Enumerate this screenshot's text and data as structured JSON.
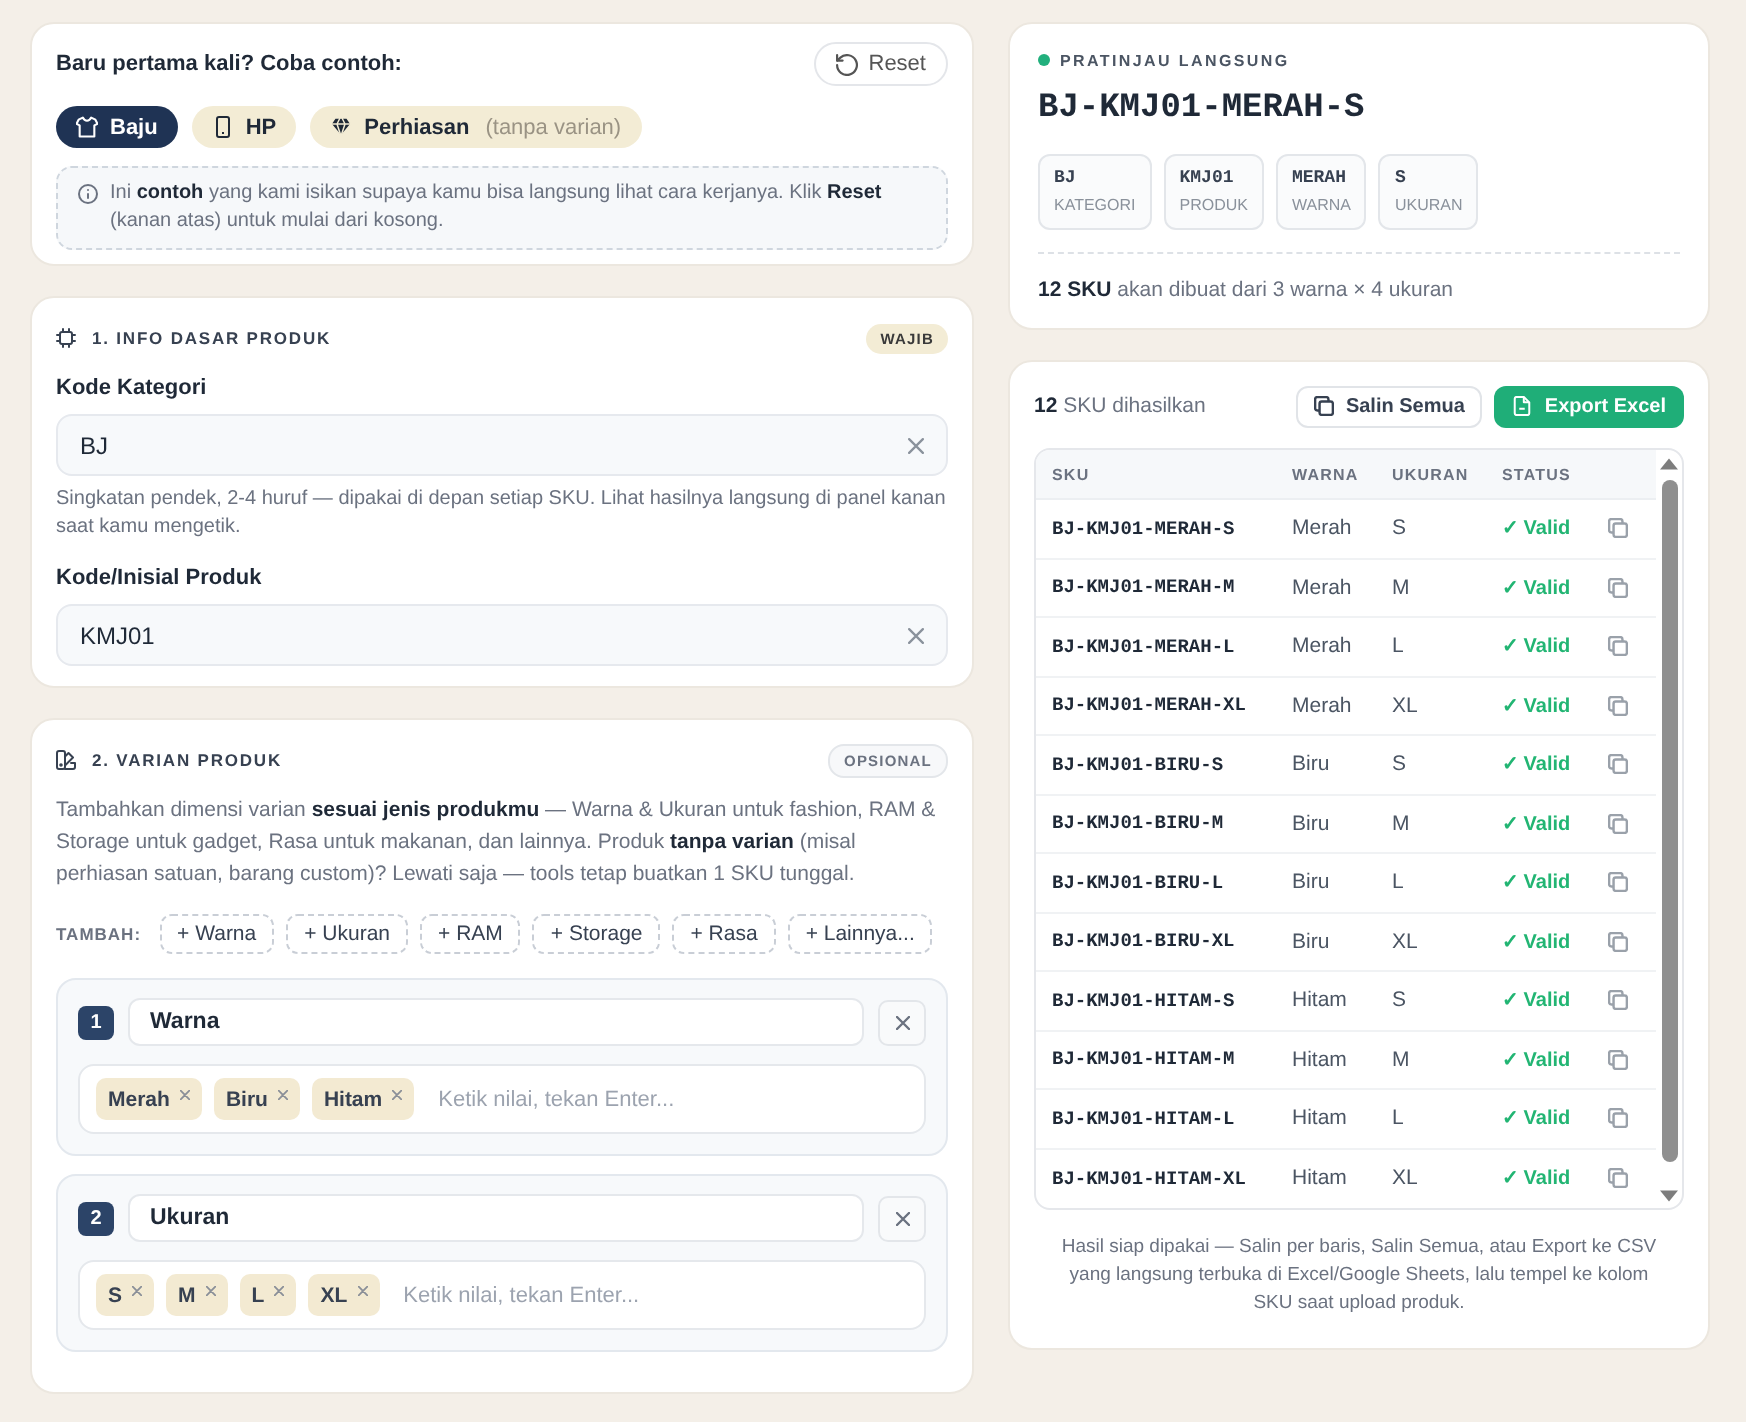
{
  "examples": {
    "title": "Baru pertama kali? Coba contoh:",
    "reset": "Reset",
    "items": [
      {
        "kind": "clothing",
        "label": "Baju",
        "selected": true
      },
      {
        "kind": "gadget",
        "label": "HP",
        "selected": false
      },
      {
        "kind": "jewelry",
        "label": "Perhiasan",
        "note": "(tanpa varian)",
        "selected": false
      }
    ],
    "info": "Ini **contoh** yang kami isikan supaya kamu bisa langsung lihat cara kerjanya. Klik **Reset** (kanan atas) untuk mulai dari kosong."
  },
  "basic_info": {
    "title": "1. INFO DASAR PRODUK",
    "badge": {
      "label": "WAJIB",
      "kind": "required"
    },
    "fields": [
      {
        "label": "Kode Kategori",
        "value": "BJ",
        "hint": "Singkatan pendek, 2-4 huruf — dipakai di depan setiap SKU. Lihat hasilnya langsung di panel kanan saat kamu mengetik."
      },
      {
        "label": "Kode/Inisial Produk",
        "value": "KMJ01"
      }
    ]
  },
  "variants": {
    "title": "2. VARIAN PRODUK",
    "badge": {
      "label": "OPSIONAL",
      "kind": "optional"
    },
    "description": "Tambahkan dimensi varian **sesuai jenis produkmu** — Warna & Ukuran untuk fashion, RAM & Storage untuk gadget, Rasa untuk makanan, dan lainnya. Produk **tanpa varian** (misal perhiasan satuan, barang custom)? Lewati saja — tools tetap buatkan 1 SKU tunggal.",
    "add_label": "TAMBAH:",
    "add_buttons": [
      "+ Warna",
      "+ Ukuran",
      "+ RAM",
      "+ Storage",
      "+ Rasa",
      "+ Lainnya..."
    ],
    "groups": [
      {
        "number": "1",
        "name": "Warna",
        "values": [
          "Merah",
          "Biru",
          "Hitam"
        ],
        "placeholder": "Ketik nilai, tekan Enter..."
      },
      {
        "number": "2",
        "name": "Ukuran",
        "values": [
          "S",
          "M",
          "L",
          "XL"
        ],
        "placeholder": "Ketik nilai, tekan Enter..."
      }
    ]
  },
  "preview": {
    "title": "PRATINJAU LANGSUNG",
    "sku": "BJ-KMJ01-MERAH-S",
    "segments": [
      {
        "value": "BJ",
        "label": "KATEGORI"
      },
      {
        "value": "KMJ01",
        "label": "PRODUK"
      },
      {
        "value": "MERAH",
        "label": "WARNA"
      },
      {
        "value": "S",
        "label": "UKURAN"
      }
    ],
    "summary": "**12 SKU** akan dibuat dari 3 warna × 4 ukuran"
  },
  "results": {
    "count": "**12** SKU dihasilkan",
    "copy_all": "Salin Semua",
    "export": "Export Excel",
    "columns": [
      "SKU",
      "WARNA",
      "UKURAN",
      "STATUS"
    ],
    "rows": [
      {
        "sku": "BJ-KMJ01-MERAH-S",
        "warna": "Merah",
        "ukuran": "S",
        "status": "✓ Valid"
      },
      {
        "sku": "BJ-KMJ01-MERAH-M",
        "warna": "Merah",
        "ukuran": "M",
        "status": "✓ Valid"
      },
      {
        "sku": "BJ-KMJ01-MERAH-L",
        "warna": "Merah",
        "ukuran": "L",
        "status": "✓ Valid"
      },
      {
        "sku": "BJ-KMJ01-MERAH-XL",
        "warna": "Merah",
        "ukuran": "XL",
        "status": "✓ Valid"
      },
      {
        "sku": "BJ-KMJ01-BIRU-S",
        "warna": "Biru",
        "ukuran": "S",
        "status": "✓ Valid"
      },
      {
        "sku": "BJ-KMJ01-BIRU-M",
        "warna": "Biru",
        "ukuran": "M",
        "status": "✓ Valid"
      },
      {
        "sku": "BJ-KMJ01-BIRU-L",
        "warna": "Biru",
        "ukuran": "L",
        "status": "✓ Valid"
      },
      {
        "sku": "BJ-KMJ01-BIRU-XL",
        "warna": "Biru",
        "ukuran": "XL",
        "status": "✓ Valid"
      },
      {
        "sku": "BJ-KMJ01-HITAM-S",
        "warna": "Hitam",
        "ukuran": "S",
        "status": "✓ Valid"
      },
      {
        "sku": "BJ-KMJ01-HITAM-M",
        "warna": "Hitam",
        "ukuran": "M",
        "status": "✓ Valid"
      },
      {
        "sku": "BJ-KMJ01-HITAM-L",
        "warna": "Hitam",
        "ukuran": "L",
        "status": "✓ Valid"
      },
      {
        "sku": "BJ-KMJ01-HITAM-XL",
        "warna": "Hitam",
        "ukuran": "XL",
        "status": "✓ Valid"
      }
    ],
    "footer": "Hasil siap dipakai — Salin per baris, Salin Semua, atau Export ke CSV yang langsung terbuka di Excel/Google Sheets, lalu tempel ke kolom SKU saat upload produk."
  }
}
